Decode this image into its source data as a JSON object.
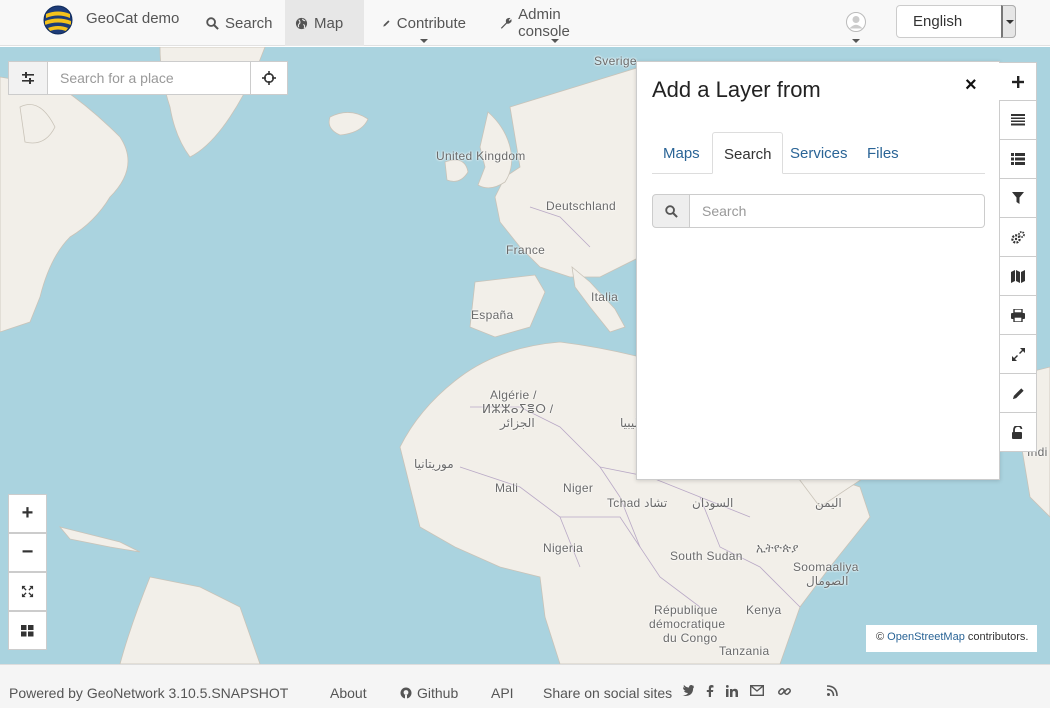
{
  "navbar": {
    "brand": "GeoCat demo",
    "items": [
      {
        "label": "Search",
        "icon": "search-icon"
      },
      {
        "label": "Map",
        "icon": "globe-icon",
        "active": true
      },
      {
        "label": "Contribute",
        "icon": "pencil-icon"
      },
      {
        "label": "Admin console",
        "icon": "wrench-icon"
      }
    ],
    "language": "English"
  },
  "map": {
    "place_search_placeholder": "Search for a place",
    "labels": {
      "sverige": "Sverige",
      "uk": "United Kingdom",
      "deutschland": "Deutschland",
      "france": "France",
      "italia": "Italia",
      "espana": "España",
      "algerie1": "Algérie /",
      "algerie2": "ⵍⵣⵣⴰⵢⴻⵔ /",
      "algerie3": "الجزائر",
      "libya": "ليبيا",
      "mauritania": "موريتانيا",
      "mali": "Mali",
      "niger": "Niger",
      "tchad": "Tchad تشاد",
      "sudan": "السودان",
      "yemen": "اليمن",
      "nigeria": "Nigeria",
      "south_sudan": "South Sudan",
      "ethiopia": "ኢትዮጵያ",
      "somalia1": "Soomaaliya",
      "somalia2": "الصومال",
      "kenya": "Kenya",
      "drc1": "République",
      "drc2": "démocratique",
      "drc3": "du Congo",
      "tanzania": "Tanzania",
      "india": "Indi"
    },
    "zoom_in": "+",
    "zoom_out": "−",
    "attribution": {
      "prefix": "©",
      "link": "OpenStreetMap",
      "suffix": "contributors."
    }
  },
  "panel": {
    "title": "Add a Layer from",
    "close": "×",
    "tabs": [
      "Maps",
      "Search",
      "Services",
      "Files"
    ],
    "active_tab": "Search",
    "search_placeholder": "Search"
  },
  "toolbar": {
    "items": [
      "add-layer-icon",
      "layers-icon",
      "list-icon",
      "filter-icon",
      "cogs-icon",
      "map-icon",
      "print-icon",
      "fullscreen-icon",
      "pencil-icon",
      "unlock-icon"
    ]
  },
  "footer": {
    "powered_by": "Powered by GeoNetwork 3.10.5.SNAPSHOT",
    "about": "About",
    "github": "Github",
    "api": "API",
    "share": "Share on social sites"
  },
  "colors": {
    "water": "#aad3df",
    "land": "#f2efe9",
    "accent": "#2a6496"
  }
}
